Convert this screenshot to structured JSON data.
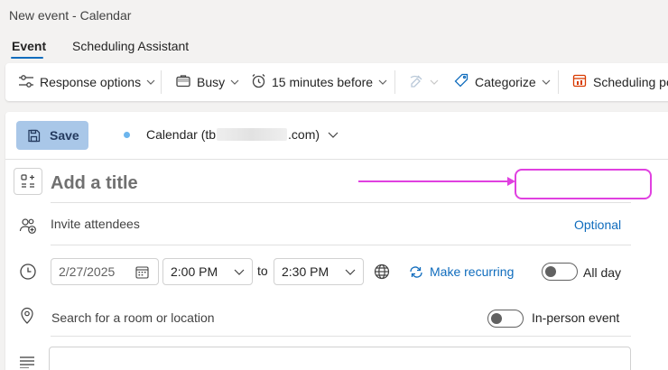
{
  "window": {
    "title": "New event - Calendar"
  },
  "tabs": [
    {
      "label": "Event",
      "active": true
    },
    {
      "label": "Scheduling Assistant",
      "active": false
    }
  ],
  "toolbar": {
    "response_options": "Response options",
    "show_as": "Busy",
    "reminder": "15 minutes before",
    "categorize": "Categorize",
    "scheduling_poll": "Scheduling po"
  },
  "form": {
    "save_label": "Save",
    "calendar_prefix": "Calendar (tb",
    "calendar_suffix": ".com)",
    "title_placeholder": "Add a title",
    "attendees_placeholder": "Invite attendees",
    "optional_label": "Optional",
    "start_date": "2/27/2025",
    "start_time": "2:00 PM",
    "to_label": "to",
    "end_time": "2:30 PM",
    "make_recurring": "Make recurring",
    "all_day_label": "All day",
    "all_day_on": false,
    "location_placeholder": "Search for a room or location",
    "in_person_label": "In-person event",
    "in_person_on": false
  },
  "colors": {
    "accent": "#0f6cbd",
    "annotation": "#e040e0",
    "save_button_bg": "#a9c7e8"
  }
}
